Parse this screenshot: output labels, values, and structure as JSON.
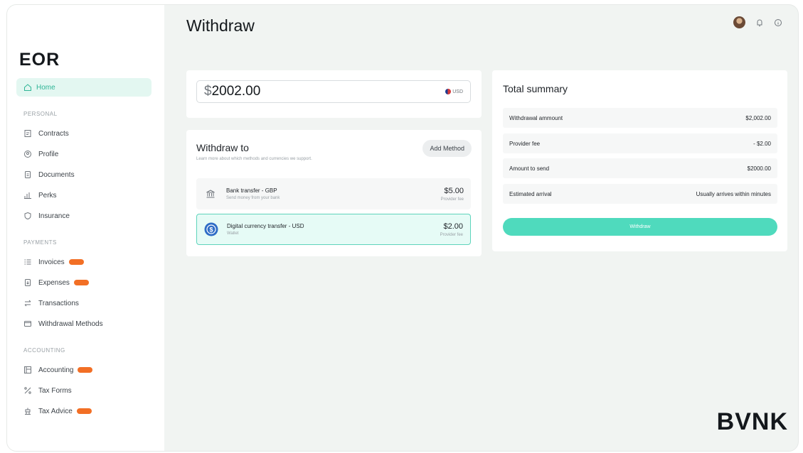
{
  "app": {
    "logo": "EOR",
    "brand": "BVNK"
  },
  "page": {
    "title": "Withdraw"
  },
  "sidebar": {
    "home": "Home",
    "sections": {
      "personal": "PERSONAL",
      "payments": "PAYMENTS",
      "accounting": "ACCOUNTING"
    },
    "items": [
      {
        "label": "Contracts",
        "icon": "contract-icon"
      },
      {
        "label": "Profile",
        "icon": "profile-icon"
      },
      {
        "label": "Documents",
        "icon": "documents-icon"
      },
      {
        "label": "Perks",
        "icon": "perks-icon"
      },
      {
        "label": "Insurance",
        "icon": "insurance-icon"
      },
      {
        "label": "Invoices",
        "icon": "invoices-icon",
        "badge": true
      },
      {
        "label": "Expenses",
        "icon": "expenses-icon",
        "badge": true
      },
      {
        "label": "Transactions",
        "icon": "transactions-icon"
      },
      {
        "label": "Withdrawal Methods",
        "icon": "wallet-icon"
      },
      {
        "label": "Accounting",
        "icon": "accounting-icon",
        "badge": true
      },
      {
        "label": "Tax Forms",
        "icon": "percent-icon"
      },
      {
        "label": "Tax Advice",
        "icon": "advice-icon",
        "badge": true
      }
    ]
  },
  "amount": {
    "symbol": "$",
    "value": "2002.00",
    "currency": "USD"
  },
  "withdraw_to": {
    "title": "Withdraw to",
    "subtitle": "Learn more about which methods and currencies we support.",
    "add_method": "Add Method",
    "methods": [
      {
        "title": "Bank transfer - GBP",
        "subtitle": "Send money from your bank",
        "price": "$5.00",
        "fee_label": "Provider fee",
        "icon": "bank-icon"
      },
      {
        "title": "Digital currency transfer - USD",
        "subtitle": "Wallet",
        "price": "$2.00",
        "fee_label": "Provider fee",
        "icon": "usdc-icon",
        "selected": true
      }
    ]
  },
  "summary": {
    "title": "Total summary",
    "rows": [
      {
        "label": "Withdrawal ammount",
        "value": "$2,002.00"
      },
      {
        "label": "Provider fee",
        "value": "- $2.00"
      },
      {
        "label": "Amount to send",
        "value": "$2000.00"
      },
      {
        "label": "Estimated arrival",
        "value": "Usually arrives within minutes"
      }
    ],
    "button": "Withdraw"
  },
  "colors": {
    "accent": "#4fdabd",
    "badge": "#f26f25",
    "selected_bg": "#e6fbf6"
  }
}
